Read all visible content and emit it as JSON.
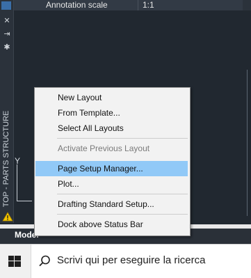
{
  "properties": {
    "key": "Annotation scale",
    "value": "1:1"
  },
  "palette": {
    "title": "TOP - PARTS STRUCTURE",
    "icons": [
      "close-icon",
      "pin-icon",
      "settings-icon"
    ]
  },
  "ucs": {
    "y_label": "Y"
  },
  "layout_tabs": {
    "model": "Model",
    "layout_tabs_hidden": [
      "",
      "",
      "",
      ""
    ]
  },
  "context_menu": {
    "items": [
      {
        "label": "New Layout",
        "enabled": true
      },
      {
        "label": "From Template...",
        "enabled": true
      },
      {
        "label": "Select All Layouts",
        "enabled": true
      },
      {
        "label": "Activate Previous Layout",
        "enabled": false
      },
      {
        "label": "Page Setup Manager...",
        "enabled": true,
        "highlighted": true
      },
      {
        "label": "Plot...",
        "enabled": true
      },
      {
        "label": "Drafting Standard Setup...",
        "enabled": true
      },
      {
        "label": "Dock above Status Bar",
        "enabled": true
      }
    ]
  },
  "taskbar": {
    "search_placeholder": "Scrivi qui per eseguire la ricerca",
    "start_icon": "windows-logo-icon",
    "search_icon": "search-icon"
  },
  "colors": {
    "highlight": "#91c9f7",
    "canvas": "#212830",
    "menu_bg": "#f2f2f2"
  }
}
